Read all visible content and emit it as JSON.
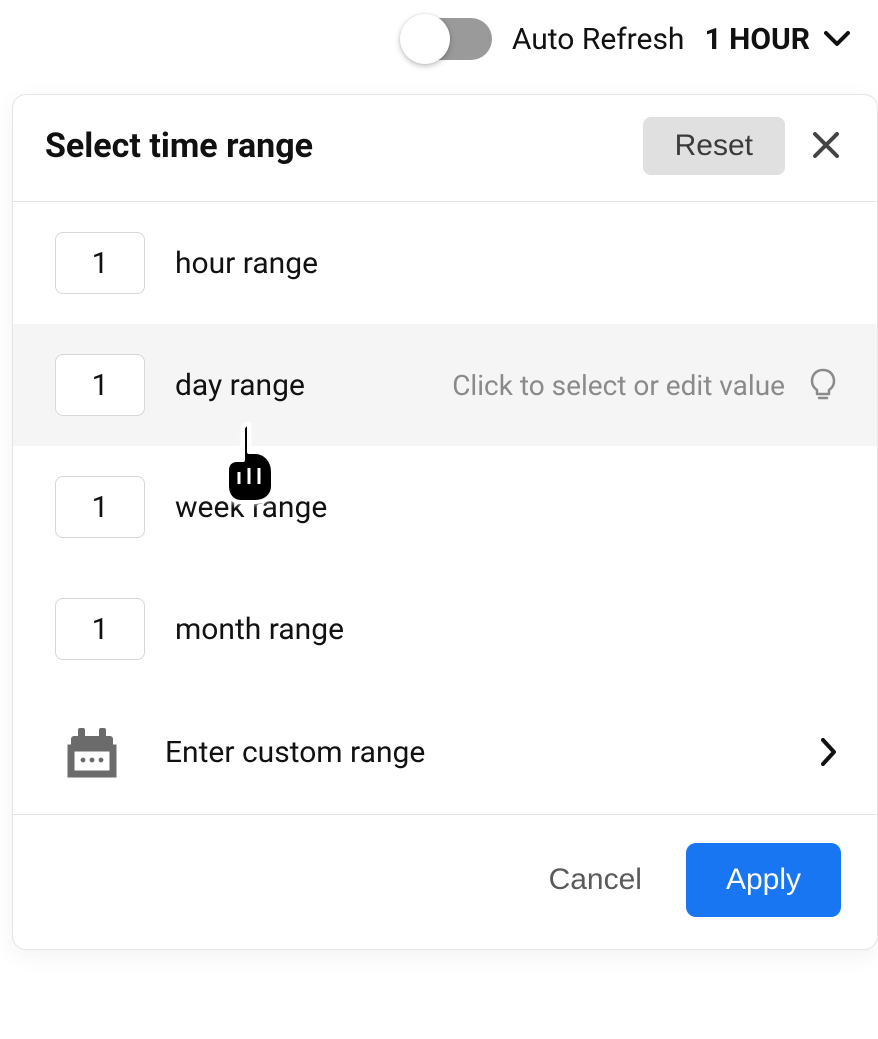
{
  "topbar": {
    "auto_refresh_label": "Auto Refresh",
    "current_value": "1 HOUR"
  },
  "popup": {
    "title": "Select time range",
    "reset_label": "Reset",
    "rows": [
      {
        "value": "1",
        "label": "hour range"
      },
      {
        "value": "1",
        "label": "day range"
      },
      {
        "value": "1",
        "label": "week range"
      },
      {
        "value": "1",
        "label": "month range"
      }
    ],
    "hover_hint": "Click to select or edit value",
    "custom_label": "Enter custom range",
    "cancel_label": "Cancel",
    "apply_label": "Apply"
  }
}
